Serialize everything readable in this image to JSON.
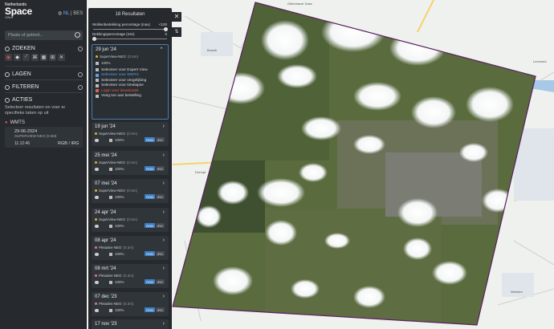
{
  "app": {
    "logo_line1": "Netherlands",
    "logo_line2": "Space",
    "logo_line3": "Office",
    "lang_nl": "NL",
    "lang_sep": "|",
    "lang_be": "BES"
  },
  "search": {
    "placeholder": "Plaats of gebied..."
  },
  "sections": {
    "zoeken": "ZOEKEN",
    "lagen": "LAGEN",
    "filteren": "FILTEREN",
    "acties": "ACTIES",
    "acties_text": "Selecteer resultaten en voer er specifieke taken op uit"
  },
  "wmts": {
    "title": "WMTS",
    "date": "29-06-2024",
    "sensor": "SUPERVIEW-NEO",
    "gsd": "(0.5M)",
    "time": "11:12:46",
    "bands": "RGB / IRG"
  },
  "results": {
    "title": "18 Resultaten",
    "cloud_label": "Wolkenbedekking percentage (max)",
    "cloud_value": "<100",
    "coverage_label": "Dekkingspercentage (min)",
    "coverage_value": "0",
    "items": [
      {
        "date": "29 jun '24",
        "sensor": "SuperView-NEO",
        "gsd": "(0.5m)",
        "pct": "100%",
        "color": "yellow",
        "expanded": true
      },
      {
        "date": "19 jun '24",
        "sensor": "SuperView-NEO",
        "gsd": "(0.5m)",
        "pct": "100%",
        "color": "yellow"
      },
      {
        "date": "25 mei '24",
        "sensor": "SuperView-NEO",
        "gsd": "(0.5m)",
        "pct": "100%",
        "color": "yellow"
      },
      {
        "date": "07 mei '24",
        "sensor": "SuperView-NEO",
        "gsd": "(0.5m)",
        "pct": "100%",
        "color": "yellow"
      },
      {
        "date": "24 apr '24",
        "sensor": "SuperView-NEO",
        "gsd": "(0.5m)",
        "pct": "100%",
        "color": "yellow"
      },
      {
        "date": "08 apr '24",
        "sensor": "Pleiades-NEO",
        "gsd": "(0.3m)",
        "pct": "100%",
        "color": "pink"
      },
      {
        "date": "08 mrt '24",
        "sensor": "Pleiades-NEO",
        "gsd": "(0.3m)",
        "pct": "100%",
        "color": "pink"
      },
      {
        "date": "07 dec '23",
        "sensor": "Pleiades-NEO",
        "gsd": "(0.3m)",
        "pct": "100%",
        "color": "pink"
      },
      {
        "date": "17 nov '23",
        "sensor": "",
        "gsd": "",
        "pct": "",
        "color": ""
      }
    ],
    "btn_rgb": "RGB",
    "btn_irg": "IRG",
    "menu": [
      {
        "label": "Selecteer voor Expert View",
        "style": "normal"
      },
      {
        "label": "Selecteer voor WMTS",
        "style": "blue"
      },
      {
        "label": "Selecteer voor vergelijking",
        "style": "normal"
      },
      {
        "label": "Selecteer voor timelapse",
        "style": "normal"
      },
      {
        "label": "Login voor downloads",
        "style": "red"
      },
      {
        "label": "Voeg toe aan bestelling",
        "style": "normal"
      }
    ]
  },
  "map": {
    "places": [
      "Bunnik",
      "Oldenhaver Kass",
      "Lexmond",
      "Drempt",
      "Wenden"
    ],
    "colors": {
      "imagery_border": "#5b1f5f",
      "pin": "#5b1f5f"
    }
  }
}
